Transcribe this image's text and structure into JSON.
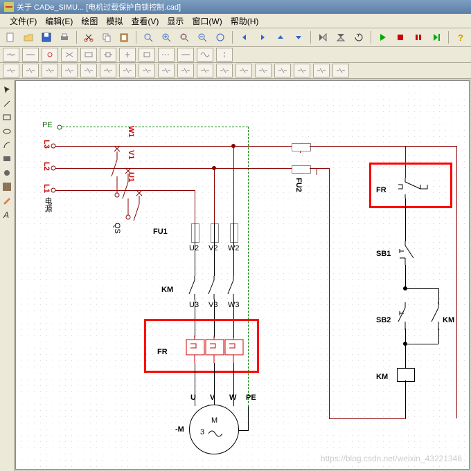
{
  "app": {
    "title_prefix": "关于 CADe_SIMU...",
    "title_doc": "[电机过载保护自锁控制.cad]"
  },
  "menu": {
    "file": "文件(F)",
    "edit": "编辑(E)",
    "draw": "绘图",
    "sim": "模拟",
    "view": "查看(V)",
    "display": "显示",
    "window": "窗口(W)",
    "help": "帮助(H)"
  },
  "diagram": {
    "labels": {
      "PE": "PE",
      "L1": "L1",
      "L2": "L2",
      "L3": "L3",
      "power": "电源",
      "W1": "W1",
      "V1": "V1",
      "U1": "U1",
      "QS": "QS",
      "FU1": "FU1",
      "U2": "U2",
      "V2": "V2",
      "W2": "W2",
      "KM": "KM",
      "U3": "U3",
      "V3": "V3",
      "W3": "W3",
      "FR": "FR",
      "U": "U",
      "V": "V",
      "W": "W",
      "PE2": "PE",
      "M_minus": "-M",
      "M": "M",
      "three": "3",
      "FU2": "FU2",
      "FR2": "FR",
      "SB1": "SB1",
      "SB2": "SB2",
      "KM2": "KM",
      "KM3": "KM"
    }
  },
  "watermark": "https://blog.csdn.net/weixin_43221346",
  "chart_data": {
    "type": "schematic",
    "title": "电机过载保护自锁控制 - Motor overload-protected self-latching control",
    "power_rails": [
      "PE",
      "L3",
      "L2",
      "L1"
    ],
    "main_circuit": [
      {
        "ref": "QS",
        "type": "3-pole isolator",
        "from": [
          "L1",
          "L2",
          "L3"
        ],
        "to": [
          "U1",
          "V1",
          "W1"
        ]
      },
      {
        "ref": "FU1",
        "type": "fuse x3",
        "from": [
          "U1",
          "V1",
          "W1"
        ],
        "to": [
          "U2",
          "V2",
          "W2"
        ]
      },
      {
        "ref": "KM",
        "type": "contactor main contacts x3",
        "from": [
          "U2",
          "V2",
          "W2"
        ],
        "to": [
          "U3",
          "V3",
          "W3"
        ]
      },
      {
        "ref": "FR",
        "type": "thermal overload relay",
        "from": [
          "U3",
          "V3",
          "W3"
        ],
        "to": [
          "U",
          "V",
          "W"
        ]
      },
      {
        "ref": "-M",
        "type": "3-phase motor",
        "terminals": [
          "U",
          "V",
          "W",
          "PE"
        ]
      }
    ],
    "control_circuit": {
      "supply_from": [
        "L2",
        "L3"
      ],
      "fuse": "FU2 (2x)",
      "series": [
        "FR (NC aux)",
        "SB1 (NC stop)",
        "SB2 (NO start) ∥ KM (NO self-hold)",
        "KM (coil)"
      ],
      "return": "L3"
    },
    "highlighted": [
      "FR thermal block",
      "FR NC auxiliary contact"
    ]
  }
}
